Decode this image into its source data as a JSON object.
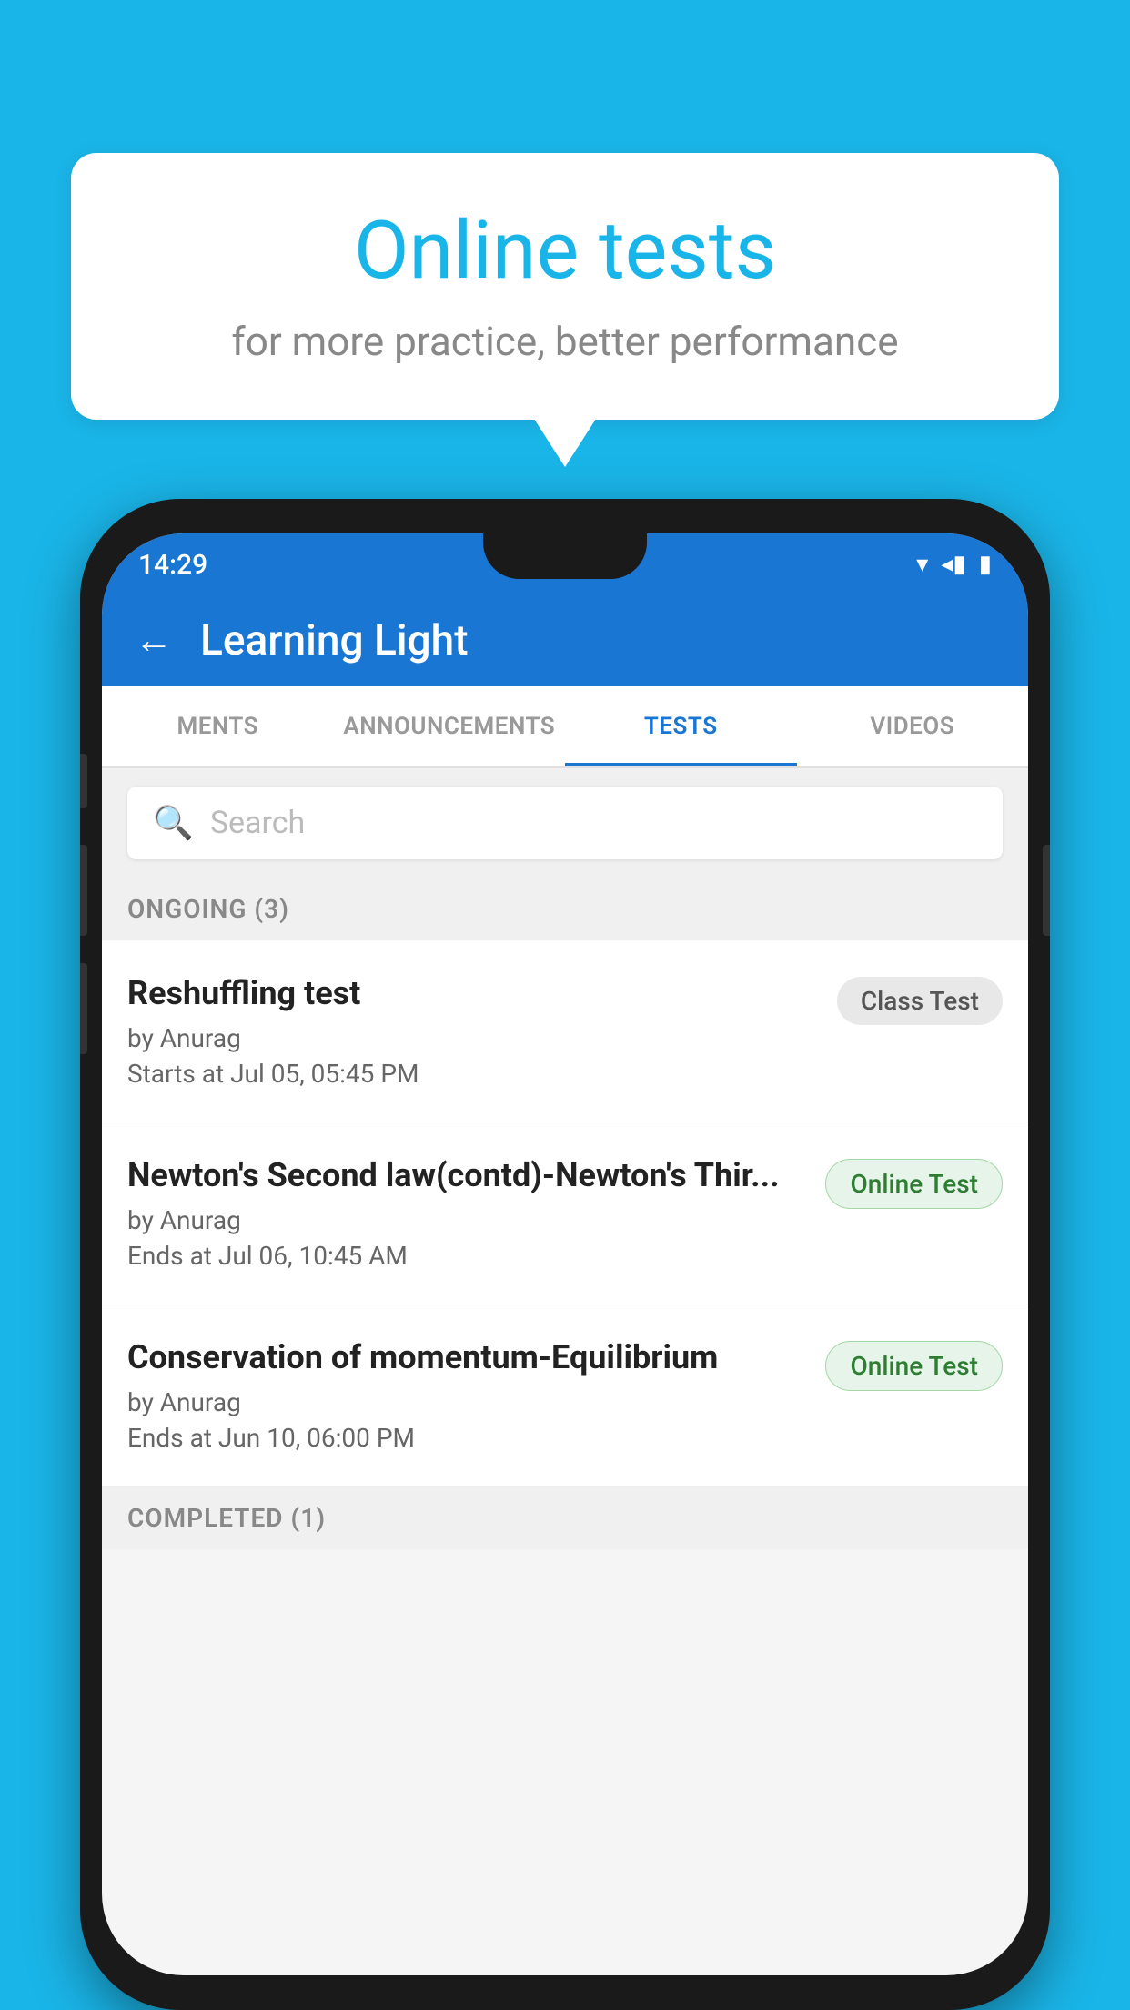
{
  "background_color": "#1ab5e8",
  "bubble": {
    "title": "Online tests",
    "subtitle": "for more practice, better performance"
  },
  "phone": {
    "status_bar": {
      "time": "14:29",
      "wifi_icon": "▾",
      "signal_icon": "◂",
      "battery_icon": "▮"
    },
    "header": {
      "back_label": "←",
      "title": "Learning Light"
    },
    "tabs": [
      {
        "label": "MENTS",
        "active": false
      },
      {
        "label": "ANNOUNCEMENTS",
        "active": false
      },
      {
        "label": "TESTS",
        "active": true
      },
      {
        "label": "VIDEOS",
        "active": false
      }
    ],
    "search": {
      "placeholder": "Search"
    },
    "ongoing_section": {
      "label": "ONGOING (3)"
    },
    "tests": [
      {
        "name": "Reshuffling test",
        "by": "by Anurag",
        "time_label": "Starts at",
        "time": "Jul 05, 05:45 PM",
        "badge": "Class Test",
        "badge_type": "class"
      },
      {
        "name": "Newton's Second law(contd)-Newton's Thir...",
        "by": "by Anurag",
        "time_label": "Ends at",
        "time": "Jul 06, 10:45 AM",
        "badge": "Online Test",
        "badge_type": "online"
      },
      {
        "name": "Conservation of momentum-Equilibrium",
        "by": "by Anurag",
        "time_label": "Ends at",
        "time": "Jun 10, 06:00 PM",
        "badge": "Online Test",
        "badge_type": "online"
      }
    ],
    "completed_section": {
      "label": "COMPLETED (1)"
    }
  }
}
